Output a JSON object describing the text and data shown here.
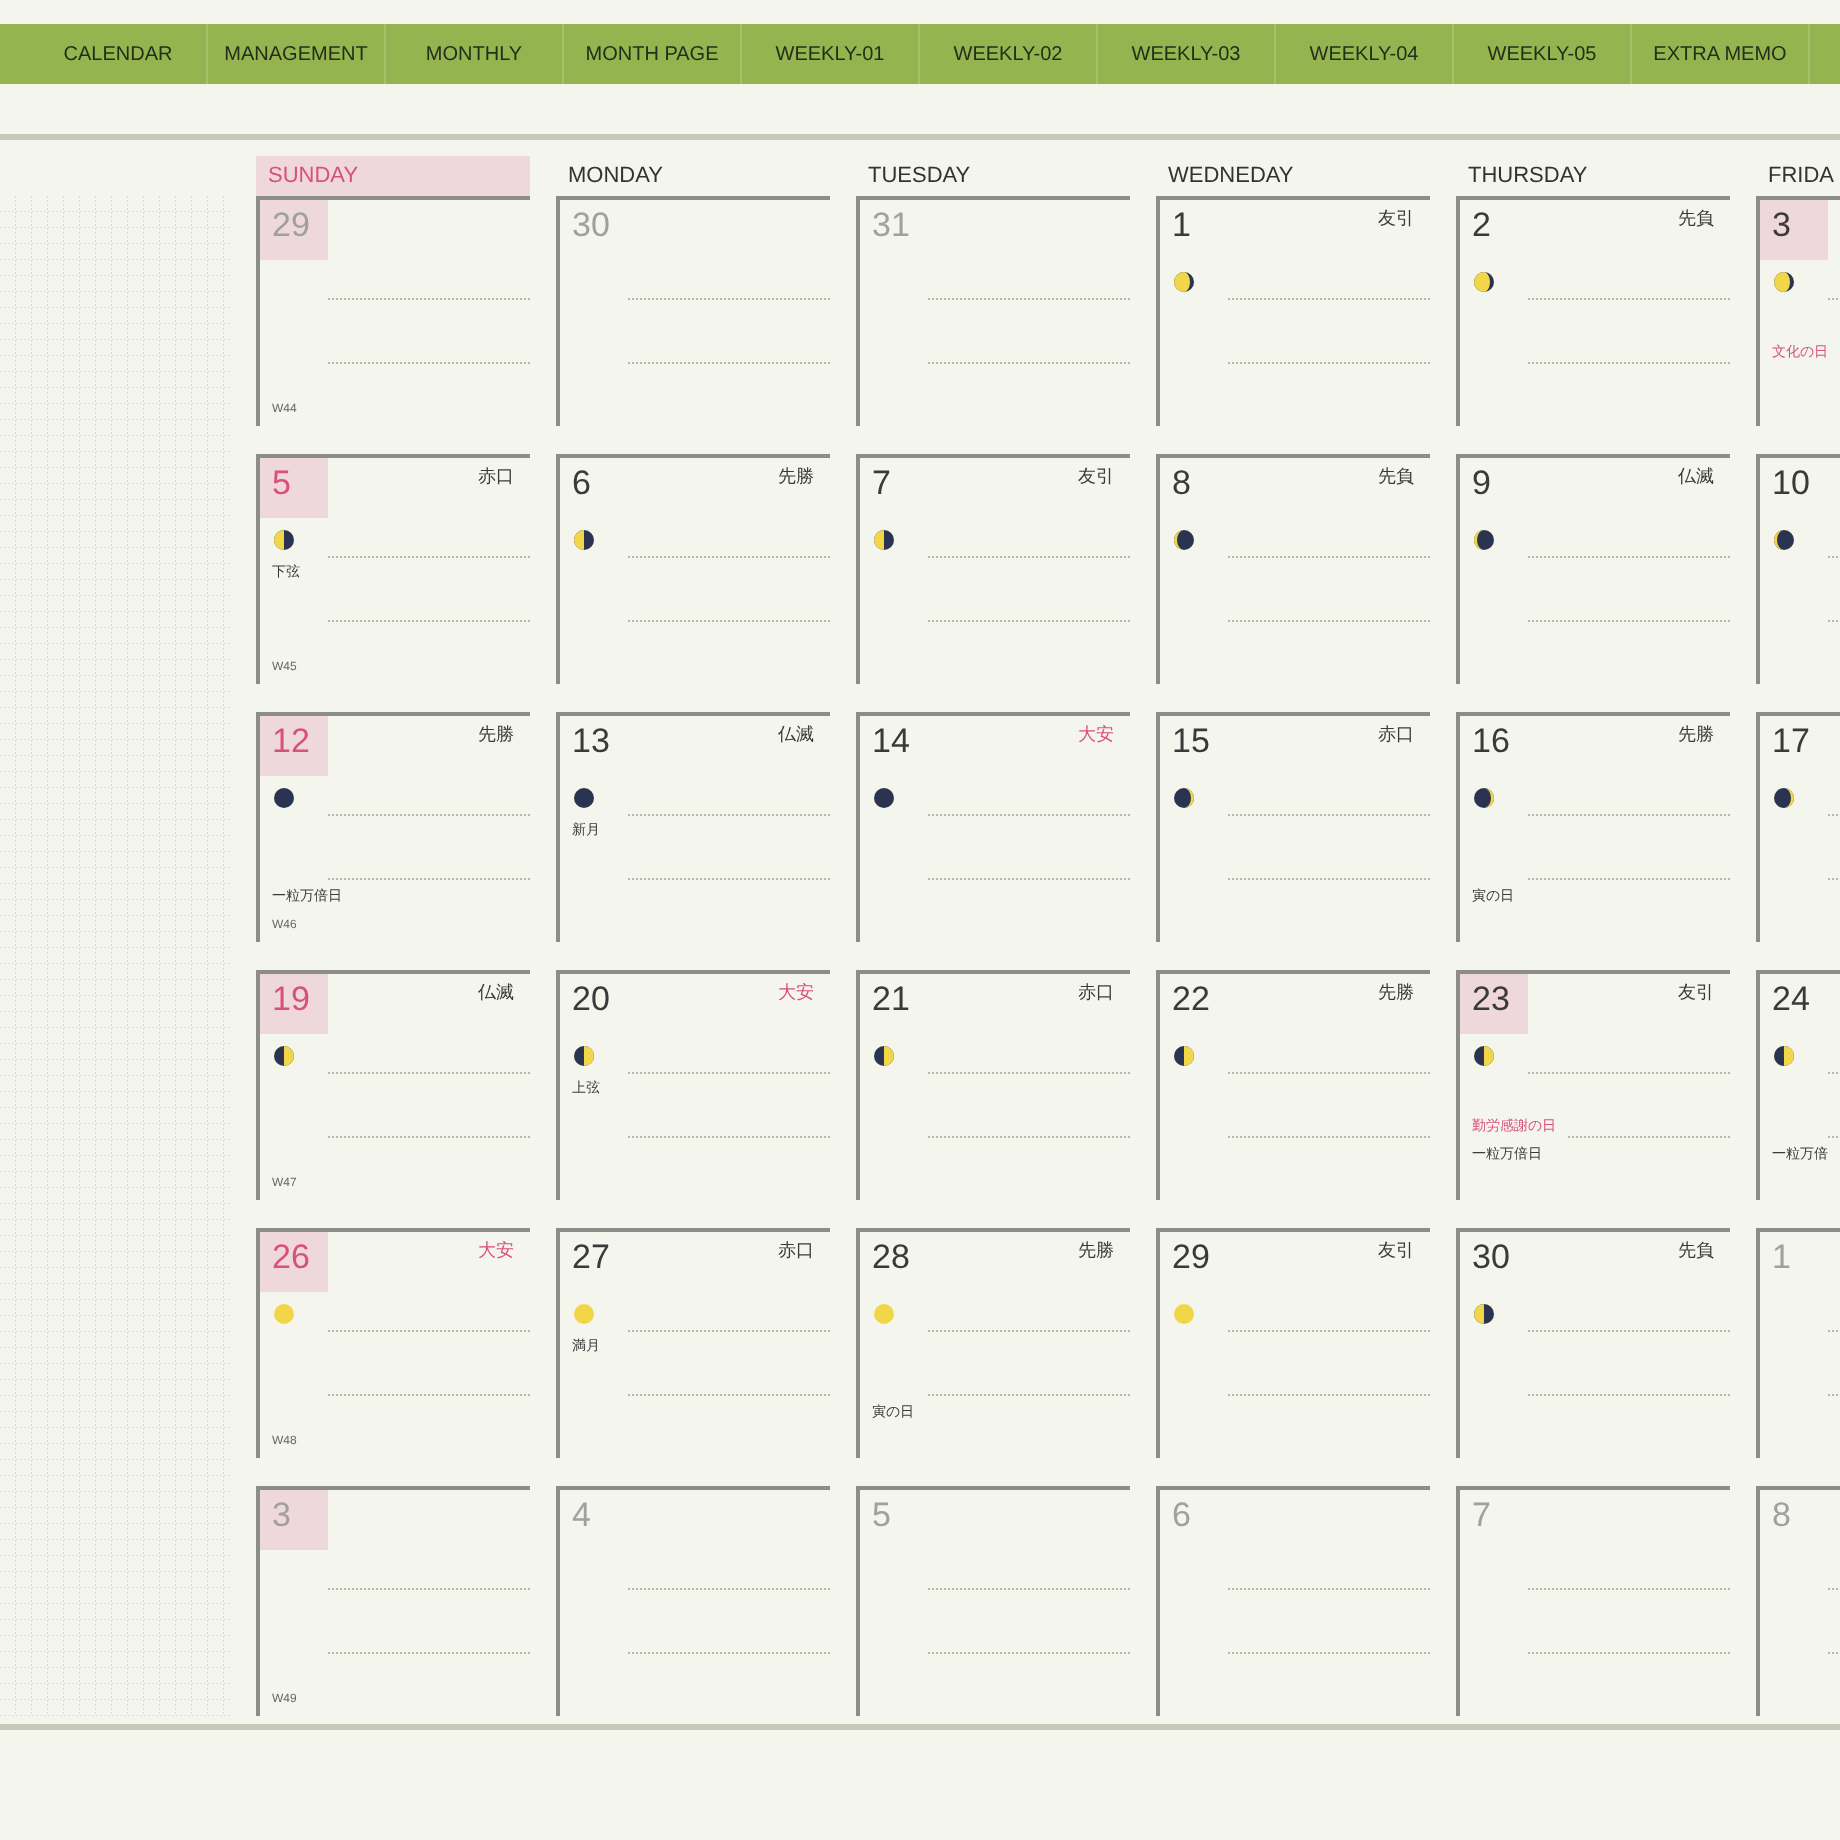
{
  "nav": {
    "tabs": [
      {
        "label": "CALENDAR"
      },
      {
        "label": "MANAGEMENT"
      },
      {
        "label": "MONTHLY"
      },
      {
        "label": "MONTH PAGE"
      },
      {
        "label": "WEEKLY-01"
      },
      {
        "label": "WEEKLY-02"
      },
      {
        "label": "WEEKLY-03"
      },
      {
        "label": "WEEKLY-04"
      },
      {
        "label": "WEEKLY-05"
      },
      {
        "label": "EXTRA MEMO"
      }
    ]
  },
  "calendar": {
    "days": [
      {
        "label": "SUNDAY",
        "kind": "sunday"
      },
      {
        "label": "MONDAY",
        "kind": "weekday"
      },
      {
        "label": "TUESDAY",
        "kind": "weekday"
      },
      {
        "label": "WEDNEDAY",
        "kind": "weekday"
      },
      {
        "label": "THURSDAY",
        "kind": "weekday"
      },
      {
        "label": "FRIDA",
        "kind": "weekday"
      }
    ],
    "weeks": [
      {
        "week": "W44",
        "cells": [
          {
            "date": "29",
            "muted": true,
            "highlight": true
          },
          {
            "date": "30",
            "muted": true,
            "highlight": false
          },
          {
            "date": "31",
            "muted": true,
            "highlight": false
          },
          {
            "date": "1",
            "muted": false,
            "red": false,
            "highlight": false,
            "rokuyo": "友引",
            "rokuyo_red": false,
            "moon": {
              "kind": "gibbous_left"
            }
          },
          {
            "date": "2",
            "muted": false,
            "red": false,
            "highlight": false,
            "rokuyo": "先負",
            "rokuyo_red": false,
            "moon": {
              "kind": "gibbous_left"
            }
          },
          {
            "date": "3",
            "muted": false,
            "red": false,
            "highlight": true,
            "moon": {
              "kind": "gibbous_left"
            },
            "notes": [
              {
                "text": "文化の日",
                "kind": "holiday"
              }
            ]
          }
        ]
      },
      {
        "week": "W45",
        "cells": [
          {
            "date": "5",
            "muted": false,
            "red": true,
            "highlight": true,
            "rokuyo": "赤口",
            "rokuyo_red": false,
            "moon": {
              "kind": "half_left"
            },
            "notes": [
              {
                "text": "下弦",
                "kind": "moon"
              }
            ]
          },
          {
            "date": "6",
            "muted": false,
            "red": false,
            "highlight": false,
            "rokuyo": "先勝",
            "rokuyo_red": false,
            "moon": {
              "kind": "half_left"
            }
          },
          {
            "date": "7",
            "muted": false,
            "red": false,
            "highlight": false,
            "rokuyo": "友引",
            "rokuyo_red": false,
            "moon": {
              "kind": "half_left"
            }
          },
          {
            "date": "8",
            "muted": false,
            "red": false,
            "highlight": false,
            "rokuyo": "先負",
            "rokuyo_red": false,
            "moon": {
              "kind": "crescent_left"
            }
          },
          {
            "date": "9",
            "muted": false,
            "red": false,
            "highlight": false,
            "rokuyo": "仏滅",
            "rokuyo_red": false,
            "moon": {
              "kind": "crescent_left"
            }
          },
          {
            "date": "10",
            "muted": false,
            "red": false,
            "highlight": false,
            "moon": {
              "kind": "crescent_left"
            }
          }
        ]
      },
      {
        "week": "W46",
        "cells": [
          {
            "date": "12",
            "muted": false,
            "red": true,
            "highlight": true,
            "rokuyo": "先勝",
            "rokuyo_red": false,
            "moon": {
              "kind": "new"
            },
            "notes": [
              {
                "text": "一粒万倍日",
                "kind": "event"
              }
            ]
          },
          {
            "date": "13",
            "muted": false,
            "red": false,
            "highlight": false,
            "rokuyo": "仏滅",
            "rokuyo_red": false,
            "moon": {
              "kind": "new"
            },
            "notes": [
              {
                "text": "新月",
                "kind": "moon"
              }
            ]
          },
          {
            "date": "14",
            "muted": false,
            "red": false,
            "highlight": false,
            "rokuyo": "大安",
            "rokuyo_red": true,
            "moon": {
              "kind": "new"
            }
          },
          {
            "date": "15",
            "muted": false,
            "red": false,
            "highlight": false,
            "rokuyo": "赤口",
            "rokuyo_red": false,
            "moon": {
              "kind": "crescent_right"
            }
          },
          {
            "date": "16",
            "muted": false,
            "red": false,
            "highlight": false,
            "rokuyo": "先勝",
            "rokuyo_red": false,
            "moon": {
              "kind": "crescent_right"
            },
            "notes": [
              {
                "text": "寅の日",
                "kind": "event"
              }
            ]
          },
          {
            "date": "17",
            "muted": false,
            "red": false,
            "highlight": false,
            "moon": {
              "kind": "crescent_right"
            }
          }
        ]
      },
      {
        "week": "W47",
        "cells": [
          {
            "date": "19",
            "muted": false,
            "red": true,
            "highlight": true,
            "rokuyo": "仏滅",
            "rokuyo_red": false,
            "moon": {
              "kind": "half_right"
            }
          },
          {
            "date": "20",
            "muted": false,
            "red": false,
            "highlight": false,
            "rokuyo": "大安",
            "rokuyo_red": true,
            "moon": {
              "kind": "half_right"
            },
            "notes": [
              {
                "text": "上弦",
                "kind": "moon"
              }
            ]
          },
          {
            "date": "21",
            "muted": false,
            "red": false,
            "highlight": false,
            "rokuyo": "赤口",
            "rokuyo_red": false,
            "moon": {
              "kind": "half_right"
            }
          },
          {
            "date": "22",
            "muted": false,
            "red": false,
            "highlight": false,
            "rokuyo": "先勝",
            "rokuyo_red": false,
            "moon": {
              "kind": "half_right"
            }
          },
          {
            "date": "23",
            "muted": false,
            "red": false,
            "highlight": true,
            "rokuyo": "友引",
            "rokuyo_red": false,
            "moon": {
              "kind": "half_right"
            },
            "notes": [
              {
                "text": "勤労感謝の日",
                "kind": "holiday"
              },
              {
                "text": "一粒万倍日",
                "kind": "event"
              }
            ]
          },
          {
            "date": "24",
            "muted": false,
            "red": false,
            "highlight": false,
            "moon": {
              "kind": "half_right"
            },
            "notes": [
              {
                "text": "一粒万倍",
                "kind": "event"
              }
            ]
          }
        ]
      },
      {
        "week": "W48",
        "cells": [
          {
            "date": "26",
            "muted": false,
            "red": true,
            "highlight": true,
            "rokuyo": "大安",
            "rokuyo_red": true,
            "moon": {
              "kind": "full"
            }
          },
          {
            "date": "27",
            "muted": false,
            "red": false,
            "highlight": false,
            "rokuyo": "赤口",
            "rokuyo_red": false,
            "moon": {
              "kind": "full"
            },
            "notes": [
              {
                "text": "満月",
                "kind": "moon"
              }
            ]
          },
          {
            "date": "28",
            "muted": false,
            "red": false,
            "highlight": false,
            "rokuyo": "先勝",
            "rokuyo_red": false,
            "moon": {
              "kind": "full"
            },
            "notes": [
              {
                "text": "寅の日",
                "kind": "event"
              }
            ]
          },
          {
            "date": "29",
            "muted": false,
            "red": false,
            "highlight": false,
            "rokuyo": "友引",
            "rokuyo_red": false,
            "moon": {
              "kind": "full"
            }
          },
          {
            "date": "30",
            "muted": false,
            "red": false,
            "highlight": false,
            "rokuyo": "先負",
            "rokuyo_red": false,
            "moon": {
              "kind": "half_left"
            }
          },
          {
            "date": "1",
            "muted": true,
            "highlight": false
          }
        ]
      },
      {
        "week": "W49",
        "cells": [
          {
            "date": "3",
            "muted": true,
            "highlight": true
          },
          {
            "date": "4",
            "muted": true,
            "highlight": false
          },
          {
            "date": "5",
            "muted": true,
            "highlight": false
          },
          {
            "date": "6",
            "muted": true,
            "highlight": false
          },
          {
            "date": "7",
            "muted": true,
            "highlight": false
          },
          {
            "date": "8",
            "muted": true,
            "highlight": false
          }
        ]
      }
    ]
  }
}
